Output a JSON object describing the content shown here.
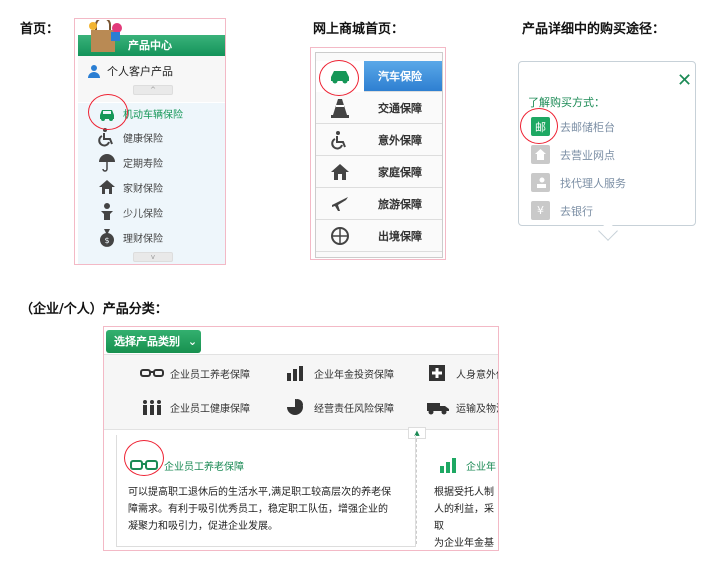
{
  "headings": {
    "home": "首页：",
    "mall": "网上商城首页：",
    "detail": "产品详细中的购买途径：",
    "category": "（企业/个人）产品分类："
  },
  "home_panel": {
    "header": "产品中心",
    "sub_header": "个人客户产品",
    "items": [
      {
        "label": "机动车辆保险",
        "icon": "car-icon",
        "active": true
      },
      {
        "label": "健康保险",
        "icon": "wheelchair-icon"
      },
      {
        "label": "定期寿险",
        "icon": "umbrella-icon"
      },
      {
        "label": "家财保险",
        "icon": "house-icon"
      },
      {
        "label": "少儿保险",
        "icon": "child-icon"
      },
      {
        "label": "理财保险",
        "icon": "money-bag-icon"
      }
    ]
  },
  "mall_panel": {
    "items": [
      {
        "label": "汽车保险",
        "icon": "car-icon",
        "active": true
      },
      {
        "label": "交通保障",
        "icon": "traffic-cone-icon"
      },
      {
        "label": "意外保障",
        "icon": "wheelchair-icon"
      },
      {
        "label": "家庭保障",
        "icon": "house-icon"
      },
      {
        "label": "旅游保障",
        "icon": "airplane-icon"
      },
      {
        "label": "出境保障",
        "icon": "globe-icon"
      }
    ]
  },
  "purchase_panel": {
    "title": "了解购买方式：",
    "options": [
      {
        "label": "去邮储柜台",
        "glyph": "邮",
        "icon": "post-office-icon",
        "active": true
      },
      {
        "label": "去营业网点",
        "glyph": "",
        "icon": "branch-icon"
      },
      {
        "label": "找代理人服务",
        "glyph": "",
        "icon": "agent-icon"
      },
      {
        "label": "去银行",
        "glyph": "¥",
        "icon": "bank-icon"
      }
    ]
  },
  "category_panel": {
    "select_button": "选择产品类别",
    "categories": [
      {
        "label": "企业员工养老保障",
        "icon": "glasses-icon"
      },
      {
        "label": "企业年金投资保障",
        "icon": "bar-chart-icon"
      },
      {
        "label": "人身意外伤",
        "icon": "medical-cross-icon"
      },
      {
        "label": "企业员工健康保障",
        "icon": "people-icon"
      },
      {
        "label": "经营责任风险保障",
        "icon": "pie-chart-icon"
      },
      {
        "label": "运输及物流",
        "icon": "truck-icon"
      }
    ],
    "detail": {
      "title": "企业员工养老保障",
      "lines": [
        "可以提高职工退休后的生活水平,满足职工较高层次的养老保",
        "障需求。有利于吸引优秀员工，稳定职工队伍，增强企业的",
        "凝聚力和吸引力，促进企业发展。"
      ]
    },
    "detail2": {
      "title": "企业年",
      "lines": [
        "根据受托人制",
        "人的利益，采取",
        "为企业年金基"
      ]
    }
  },
  "colors": {
    "green": "#1b8a55",
    "blue": "#2e7fd1",
    "highlight_circle": "#e22233"
  }
}
